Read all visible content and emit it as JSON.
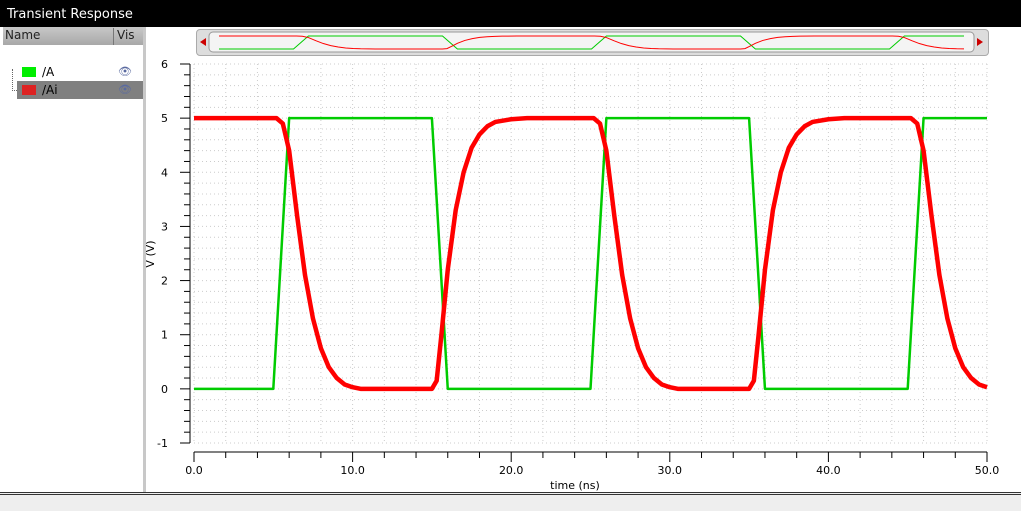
{
  "window": {
    "title": "Transient Response"
  },
  "legend": {
    "col_name": "Name",
    "col_vis": "Vis",
    "items": [
      {
        "label": "/A",
        "color": "#00dd00",
        "icon": "eye-icon",
        "selected": false
      },
      {
        "label": "/Ai",
        "color": "#dd2222",
        "icon": "eye-icon",
        "selected": true
      }
    ]
  },
  "chart_data": {
    "type": "line",
    "title": "Transient Response",
    "xlabel": "time (ns)",
    "ylabel": "V (V)",
    "xlim": [
      0,
      50
    ],
    "ylim": [
      -1,
      6
    ],
    "grid": true,
    "xticks": [
      "0.0",
      "10.0",
      "20.0",
      "30.0",
      "40.0",
      "50.0"
    ],
    "xtick_values": [
      0,
      10,
      20,
      30,
      40,
      50
    ],
    "yticks": [
      "-1",
      "0",
      "1",
      "2",
      "3",
      "4",
      "5",
      "6"
    ],
    "ytick_values": [
      -1,
      0,
      1,
      2,
      3,
      4,
      5,
      6
    ],
    "series": [
      {
        "name": "/A",
        "color": "#00cc00",
        "points": [
          [
            0,
            0
          ],
          [
            5,
            0
          ],
          [
            6,
            5
          ],
          [
            15,
            5
          ],
          [
            16,
            0
          ],
          [
            25,
            0
          ],
          [
            26,
            5
          ],
          [
            35,
            5
          ],
          [
            36,
            0
          ],
          [
            45,
            0
          ],
          [
            46,
            5
          ],
          [
            50,
            5
          ]
        ]
      },
      {
        "name": "/Ai",
        "color": "#ff0000",
        "points": [
          [
            0,
            5
          ],
          [
            5.2,
            5
          ],
          [
            5.6,
            4.9
          ],
          [
            6,
            4.4
          ],
          [
            6.5,
            3.2
          ],
          [
            7,
            2.1
          ],
          [
            7.5,
            1.3
          ],
          [
            8,
            0.75
          ],
          [
            8.5,
            0.4
          ],
          [
            9,
            0.2
          ],
          [
            9.5,
            0.08
          ],
          [
            10,
            0.03
          ],
          [
            10.5,
            0
          ],
          [
            15,
            0
          ],
          [
            15.3,
            0.15
          ],
          [
            15.6,
            1
          ],
          [
            16,
            2.2
          ],
          [
            16.5,
            3.3
          ],
          [
            17,
            4.0
          ],
          [
            17.5,
            4.45
          ],
          [
            18,
            4.7
          ],
          [
            18.5,
            4.85
          ],
          [
            19,
            4.93
          ],
          [
            20,
            4.98
          ],
          [
            21,
            5
          ],
          [
            25.2,
            5
          ],
          [
            25.6,
            4.9
          ],
          [
            26,
            4.4
          ],
          [
            26.5,
            3.2
          ],
          [
            27,
            2.1
          ],
          [
            27.5,
            1.3
          ],
          [
            28,
            0.75
          ],
          [
            28.5,
            0.4
          ],
          [
            29,
            0.2
          ],
          [
            29.5,
            0.08
          ],
          [
            30,
            0.03
          ],
          [
            30.5,
            0
          ],
          [
            35,
            0
          ],
          [
            35.3,
            0.15
          ],
          [
            35.6,
            1
          ],
          [
            36,
            2.2
          ],
          [
            36.5,
            3.3
          ],
          [
            37,
            4.0
          ],
          [
            37.5,
            4.45
          ],
          [
            38,
            4.7
          ],
          [
            38.5,
            4.85
          ],
          [
            39,
            4.93
          ],
          [
            40,
            4.98
          ],
          [
            41,
            5
          ],
          [
            45.2,
            5
          ],
          [
            45.6,
            4.9
          ],
          [
            46,
            4.4
          ],
          [
            46.5,
            3.2
          ],
          [
            47,
            2.1
          ],
          [
            47.5,
            1.3
          ],
          [
            48,
            0.75
          ],
          [
            48.5,
            0.4
          ],
          [
            49,
            0.2
          ],
          [
            49.5,
            0.08
          ],
          [
            50,
            0.03
          ]
        ]
      }
    ]
  }
}
